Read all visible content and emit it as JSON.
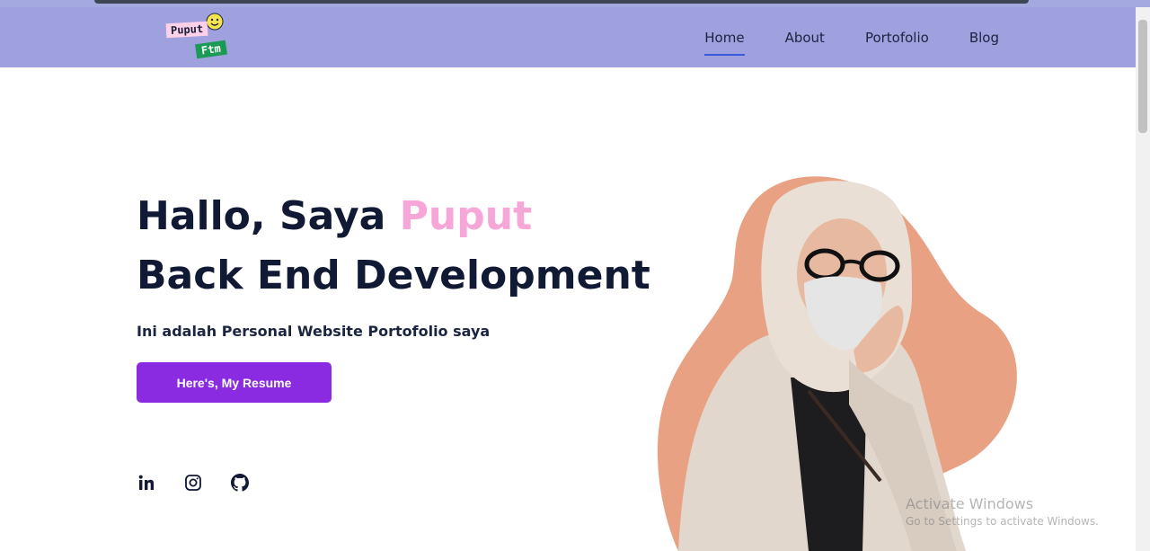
{
  "logo": {
    "line1": "Puput",
    "line2": "Ftm"
  },
  "nav": {
    "items": [
      {
        "label": "Home",
        "active": true
      },
      {
        "label": "About",
        "active": false
      },
      {
        "label": "Portofolio",
        "active": false
      },
      {
        "label": "Blog",
        "active": false
      }
    ]
  },
  "hero": {
    "greeting": "Hallo, Saya ",
    "name": "Puput",
    "role": "Back End Development",
    "tagline": "Ini adalah Personal Website Portofolio saya",
    "cta_label": "Here's, My Resume"
  },
  "socials": [
    {
      "icon": "linkedin-icon"
    },
    {
      "icon": "instagram-icon"
    },
    {
      "icon": "github-icon"
    }
  ],
  "watermark": {
    "line1": "Activate Windows",
    "line2": "Go to Settings to activate Windows."
  },
  "colors": {
    "navbar": "#9fa0de",
    "accent_pink": "#f7a6d8",
    "button": "#8a2be2",
    "blob": "#e9a184",
    "text_dark": "#111a34"
  }
}
